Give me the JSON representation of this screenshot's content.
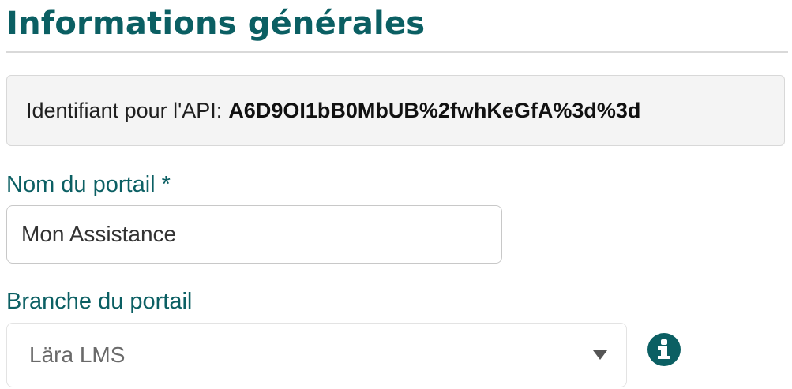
{
  "section": {
    "title": "Informations générales"
  },
  "api": {
    "label": "Identifiant pour l'API:",
    "value": "A6D9OI1bB0MbUB%2fwhKeGfA%3d%3d"
  },
  "portal_name": {
    "label": "Nom du portail *",
    "value": "Mon Assistance"
  },
  "portal_branch": {
    "label": "Branche du portail",
    "selected": "Lära LMS",
    "caret_icon": "caret-down-icon",
    "info_icon": "info-circle-icon"
  },
  "colors": {
    "accent": "#0b5f63",
    "box_background": "#f4f4f4"
  }
}
